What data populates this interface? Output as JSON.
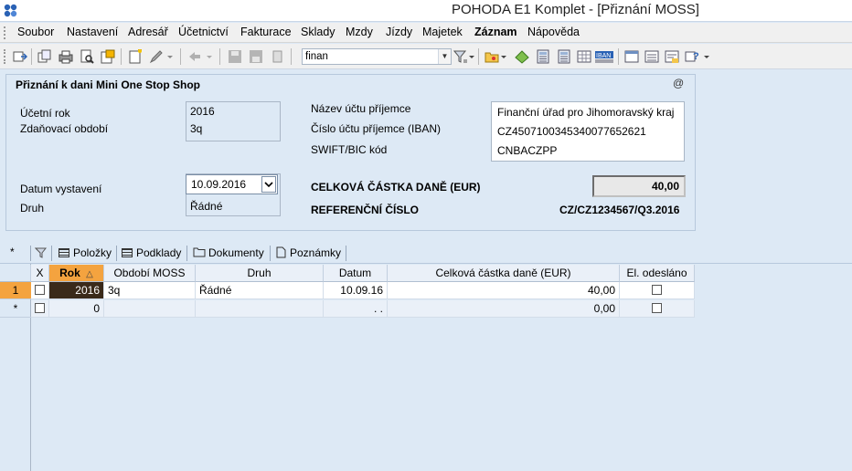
{
  "window": {
    "title": "POHODA E1 Komplet - [Přiznání MOSS]"
  },
  "menu": {
    "items": [
      {
        "label": "Soubor",
        "bold": false
      },
      {
        "label": "Nastavení",
        "bold": false
      },
      {
        "label": "Adresář",
        "bold": false
      },
      {
        "label": "Účetnictví",
        "bold": false
      },
      {
        "label": "Fakturace",
        "bold": false
      },
      {
        "label": "Sklady",
        "bold": false
      },
      {
        "label": "Mzdy",
        "bold": false
      },
      {
        "label": "Jízdy",
        "bold": false
      },
      {
        "label": "Majetek",
        "bold": false
      },
      {
        "label": "Záznam",
        "bold": true
      },
      {
        "label": "Nápověda",
        "bold": false
      }
    ]
  },
  "toolbar": {
    "search_value": "finan",
    "icons": [
      "agenda-icon",
      "copy-icon",
      "print-icon",
      "print-preview-icon",
      "export-icon",
      "new-record-icon",
      "edit-icon",
      "back-icon",
      "save-icon",
      "delete-icon",
      "attach-icon",
      "filter-icon",
      "open-folder-icon",
      "money-icon",
      "calculator-icon",
      "grid-icon",
      "iban-icon",
      "window-icon",
      "list-icon",
      "notes-icon",
      "help-icon"
    ]
  },
  "form": {
    "title": "Přiznání k dani Mini One Stop Shop",
    "at_symbol": "@",
    "rok_label": "Účetní rok",
    "rok_value": "2016",
    "obdobi_label": "Zdaňovací období",
    "obdobi_value": "3q",
    "nazev_label": "Název účtu příjemce",
    "nazev_value": "Finanční úřad pro Jihomoravský kraj",
    "iban_label": "Číslo účtu příjemce (IBAN)",
    "iban_value": "CZ4507100345340077652621",
    "swift_label": "SWIFT/BIC kód",
    "swift_value": "CNBACZPP",
    "datum_label": "Datum vystavení",
    "datum_value": "10.09.2016",
    "druh_label": "Druh",
    "druh_value": "Řádné",
    "total_label": "CELKOVÁ ČÁSTKA DANĚ (EUR)",
    "total_value": "40,00",
    "ref_label": "REFERENČNÍ ČÍSLO",
    "ref_value": "CZ/CZ1234567/Q3.2016"
  },
  "tabs": {
    "star": "*",
    "items": [
      {
        "label": "Položky"
      },
      {
        "label": "Podklady"
      },
      {
        "label": "Dokumenty"
      },
      {
        "label": "Poznámky"
      }
    ]
  },
  "grid": {
    "headers": [
      "X",
      "Rok",
      "Období MOSS",
      "Druh",
      "Datum",
      "Celková částka daně (EUR)",
      "El. odesláno"
    ],
    "sort_arrow": "△",
    "rows": [
      {
        "num": "1",
        "rok": "2016",
        "obdobi": "3q",
        "druh": "Řádné",
        "datum": "10.09.16",
        "castka": "40,00"
      },
      {
        "num": "*",
        "rok": "0",
        "obdobi": "",
        "druh": "",
        "datum": ". .",
        "castka": "0,00"
      }
    ]
  }
}
